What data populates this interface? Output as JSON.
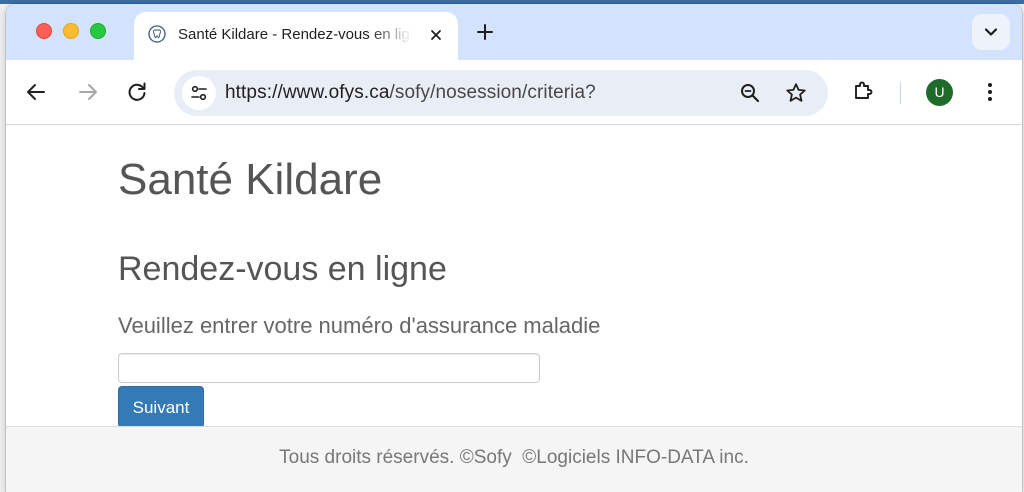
{
  "browser": {
    "tab": {
      "title": "Santé Kildare - Rendez-vous en ligne",
      "favicon": "tooth-icon"
    },
    "address_bar": {
      "url_host": "https://www.ofys.ca",
      "url_path": "/sofy/nosession/criteria?"
    },
    "profile_initial": "U",
    "colors": {
      "tabstrip": "#d3e3fd",
      "omnibox": "#e9eef6",
      "avatar": "#1e6b2a"
    }
  },
  "page": {
    "site_title": "Santé Kildare",
    "section_title": "Rendez-vous en ligne",
    "field_label": "Veuillez entrer votre numéro d'assurance maladie",
    "nam_input": {
      "value": "",
      "placeholder": ""
    },
    "next_button_label": "Suivant",
    "footer_text": "Tous droits réservés. ©Sofy  ©Logiciels INFO-DATA inc.",
    "colors": {
      "primary_button": "#337ab7",
      "heading_text": "#555555",
      "footer_bg": "#f5f5f5"
    }
  }
}
